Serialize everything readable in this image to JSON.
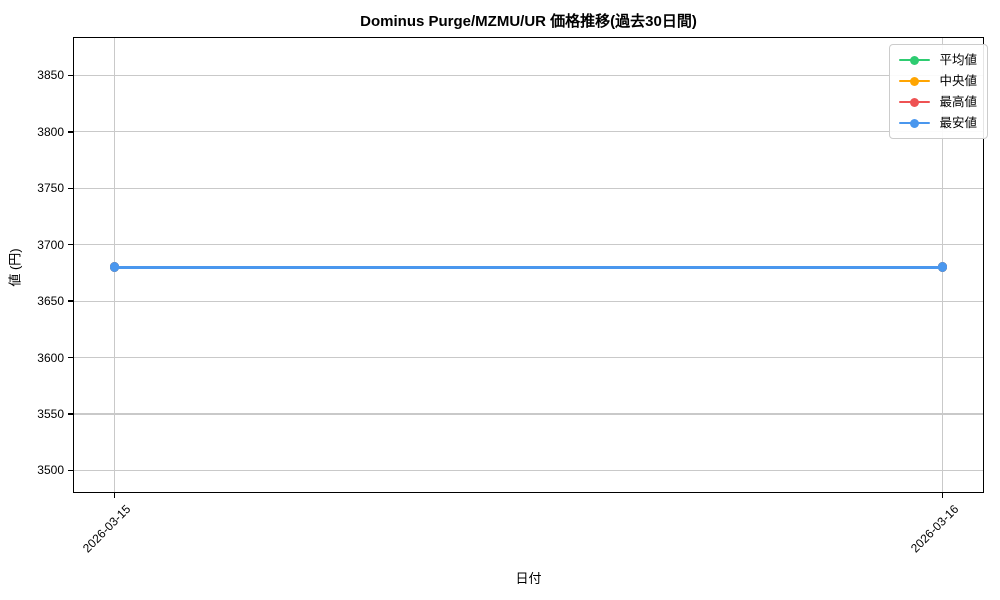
{
  "title": "Dominus Purge/MZMU/UR 価格推移(過去30日間)",
  "chart_data": {
    "type": "line",
    "title": "Dominus Purge/MZMU/UR 価格推移(過去30日間)",
    "xlabel": "日付",
    "ylabel": "値 (円)",
    "categories": [
      "2026-03-15",
      "2026-03-16"
    ],
    "series": [
      {
        "name": "平均値",
        "color": "#2ecc71",
        "values": [
          3680,
          3680
        ]
      },
      {
        "name": "中央値",
        "color": "#ffa502",
        "values": [
          3680,
          3680
        ]
      },
      {
        "name": "最高値",
        "color": "#ee5253",
        "values": [
          3680,
          3680
        ]
      },
      {
        "name": "最安値",
        "color": "#4a97ee",
        "values": [
          3680,
          3680
        ]
      }
    ],
    "ylim": [
      3480,
      3884
    ],
    "y_ticks": [
      3500,
      3550,
      3600,
      3650,
      3700,
      3750,
      3800,
      3850
    ],
    "grid": true,
    "legend_position": "upper right",
    "x_tick_rotation": 45,
    "axis_color": "#000000",
    "grid_color": "#c9c9c9"
  }
}
